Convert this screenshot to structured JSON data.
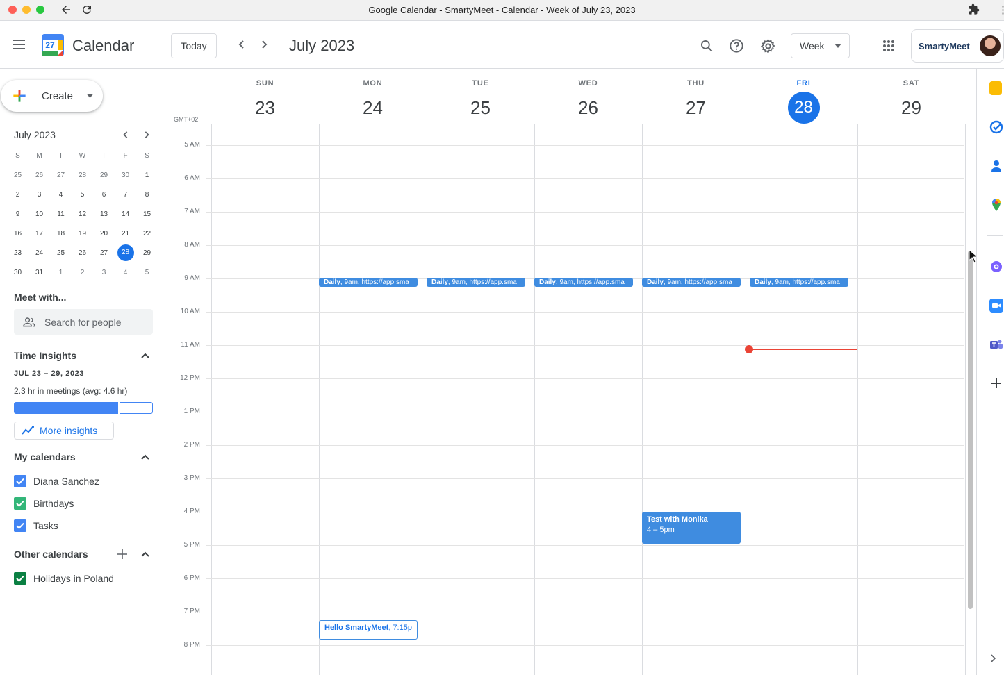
{
  "browser": {
    "title": "Google Calendar - SmartyMeet - Calendar - Week of July 23, 2023"
  },
  "header": {
    "app_name": "Calendar",
    "logo_day": "27",
    "today_label": "Today",
    "month_title": "July 2023",
    "view_label": "Week",
    "account_label": "SmartyMeet"
  },
  "sidebar": {
    "create_label": "Create",
    "mini_cal": {
      "title": "July 2023",
      "weekdays": [
        "S",
        "M",
        "T",
        "W",
        "T",
        "F",
        "S"
      ],
      "weeks": [
        [
          "25",
          "26",
          "27",
          "28",
          "29",
          "30",
          "1"
        ],
        [
          "2",
          "3",
          "4",
          "5",
          "6",
          "7",
          "8"
        ],
        [
          "9",
          "10",
          "11",
          "12",
          "13",
          "14",
          "15"
        ],
        [
          "16",
          "17",
          "18",
          "19",
          "20",
          "21",
          "22"
        ],
        [
          "23",
          "24",
          "25",
          "26",
          "27",
          "28",
          "29"
        ],
        [
          "30",
          "31",
          "1",
          "2",
          "3",
          "4",
          "5"
        ]
      ],
      "today": "28"
    },
    "meet_with": {
      "title": "Meet with...",
      "placeholder": "Search for people"
    },
    "insights": {
      "title": "Time Insights",
      "range": "JUL 23 – 29, 2023",
      "summary": "2.3 hr in meetings (avg: 4.6 hr)",
      "meeting_fraction": 0.76,
      "more_label": "More insights"
    },
    "my_calendars": {
      "title": "My calendars",
      "items": [
        {
          "label": "Diana Sanchez",
          "color": "#4285f4"
        },
        {
          "label": "Birthdays",
          "color": "#33b679"
        },
        {
          "label": "Tasks",
          "color": "#4285f4"
        }
      ]
    },
    "other_calendars": {
      "title": "Other calendars",
      "items": [
        {
          "label": "Holidays in Poland",
          "color": "#0b8043"
        }
      ]
    }
  },
  "week": {
    "timezone": "GMT+02",
    "days": [
      {
        "name": "SUN",
        "date": "23"
      },
      {
        "name": "MON",
        "date": "24"
      },
      {
        "name": "TUE",
        "date": "25"
      },
      {
        "name": "WED",
        "date": "26"
      },
      {
        "name": "THU",
        "date": "27"
      },
      {
        "name": "FRI",
        "date": "28",
        "today": true
      },
      {
        "name": "SAT",
        "date": "29"
      }
    ],
    "hours": [
      "5 AM",
      "6 AM",
      "7 AM",
      "8 AM",
      "9 AM",
      "10 AM",
      "11 AM",
      "12 PM",
      "1 PM",
      "2 PM",
      "3 PM",
      "4 PM",
      "5 PM",
      "6 PM",
      "7 PM",
      "8 PM"
    ],
    "events": [
      {
        "title": "Daily",
        "detail": "9am, https://app.sma",
        "day_index": 1
      },
      {
        "title": "Daily",
        "detail": "9am, https://app.sma",
        "day_index": 2
      },
      {
        "title": "Daily",
        "detail": "9am, https://app.sma",
        "day_index": 3
      },
      {
        "title": "Daily",
        "detail": "9am, https://app.sma",
        "day_index": 4
      },
      {
        "title": "Daily",
        "detail": "9am, https://app.sma",
        "day_index": 5
      },
      {
        "title": "Test with Monika",
        "detail": "4 – 5pm",
        "day_index": 4
      },
      {
        "title": "Hello SmartyMeet",
        "detail": "7:15p",
        "day_index": 1
      }
    ]
  },
  "colors": {
    "accent": "#1a73e8",
    "event": "#3f8ce0",
    "now_line": "#ea4335"
  }
}
